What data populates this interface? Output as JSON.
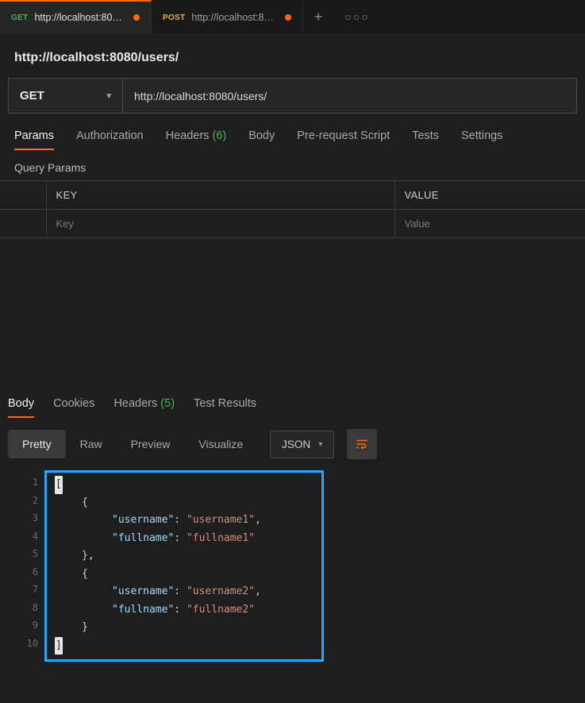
{
  "tabs": [
    {
      "method": "GET",
      "method_class": "get",
      "label": "http://localhost:80…",
      "dirty": true,
      "active": true
    },
    {
      "method": "POST",
      "method_class": "post",
      "label": "http://localhost:8…",
      "dirty": true,
      "active": false
    }
  ],
  "request": {
    "title": "http://localhost:8080/users/",
    "method": "GET",
    "url": "http://localhost:8080/users/"
  },
  "reqtabs": {
    "params": "Params",
    "auth": "Authorization",
    "headers": "Headers",
    "headers_count": "(6)",
    "body": "Body",
    "prerequest": "Pre-request Script",
    "tests": "Tests",
    "settings": "Settings"
  },
  "query_params": {
    "heading": "Query Params",
    "key_header": "KEY",
    "value_header": "VALUE",
    "key_placeholder": "Key",
    "value_placeholder": "Value"
  },
  "resptabs": {
    "body": "Body",
    "cookies": "Cookies",
    "headers": "Headers",
    "headers_count": "(5)",
    "test_results": "Test Results"
  },
  "view": {
    "pretty": "Pretty",
    "raw": "Raw",
    "preview": "Preview",
    "visualize": "Visualize",
    "format": "JSON"
  },
  "response_body": [
    {
      "n": 1,
      "indent": 0,
      "tokens": [
        {
          "t": "bracket-hi",
          "v": "["
        }
      ]
    },
    {
      "n": 2,
      "indent": 1,
      "tokens": [
        {
          "t": "punct",
          "v": "{"
        }
      ]
    },
    {
      "n": 3,
      "indent": 2,
      "tokens": [
        {
          "t": "key",
          "v": "\"username\""
        },
        {
          "t": "punct",
          "v": ":"
        },
        {
          "t": "sp"
        },
        {
          "t": "str",
          "v": "\"username1\""
        },
        {
          "t": "punct",
          "v": ","
        }
      ]
    },
    {
      "n": 4,
      "indent": 2,
      "tokens": [
        {
          "t": "key",
          "v": "\"fullname\""
        },
        {
          "t": "punct",
          "v": ":"
        },
        {
          "t": "sp"
        },
        {
          "t": "str",
          "v": "\"fullname1\""
        }
      ]
    },
    {
      "n": 5,
      "indent": 1,
      "tokens": [
        {
          "t": "punct",
          "v": "},"
        }
      ]
    },
    {
      "n": 6,
      "indent": 1,
      "tokens": [
        {
          "t": "punct",
          "v": "{"
        }
      ]
    },
    {
      "n": 7,
      "indent": 2,
      "tokens": [
        {
          "t": "key",
          "v": "\"username\""
        },
        {
          "t": "punct",
          "v": ":"
        },
        {
          "t": "sp"
        },
        {
          "t": "str",
          "v": "\"username2\""
        },
        {
          "t": "punct",
          "v": ","
        }
      ]
    },
    {
      "n": 8,
      "indent": 2,
      "tokens": [
        {
          "t": "key",
          "v": "\"fullname\""
        },
        {
          "t": "punct",
          "v": ":"
        },
        {
          "t": "sp"
        },
        {
          "t": "str",
          "v": "\"fullname2\""
        }
      ]
    },
    {
      "n": 9,
      "indent": 1,
      "tokens": [
        {
          "t": "punct",
          "v": "}"
        }
      ]
    },
    {
      "n": 10,
      "indent": 0,
      "tokens": [
        {
          "t": "bracket-hi",
          "v": "]"
        }
      ]
    }
  ]
}
